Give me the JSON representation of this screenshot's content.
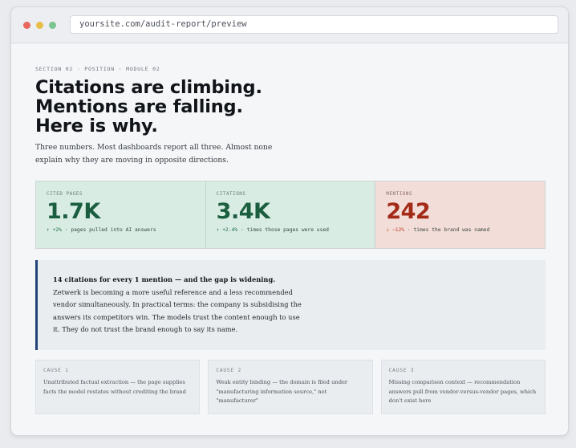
{
  "browser": {
    "url": "yoursite.com/audit-report/preview"
  },
  "header": {
    "eyebrow": "SECTION 02 · POSITION · MODULE 02",
    "headline_lines": [
      "Citations are climbing.",
      "Mentions are falling.",
      "Here is why."
    ],
    "subhead": "Three numbers. Most dashboards report all three. Almost none explain why they are moving in opposite directions."
  },
  "stats": [
    {
      "label": "CITED PAGES",
      "value": "1.7K",
      "arrow": "↑",
      "delta": "+2%",
      "note": "· pages pulled into AI answers",
      "tone": "green"
    },
    {
      "label": "CITATIONS",
      "value": "3.4K",
      "arrow": "↑",
      "delta": "+2.4%",
      "note": "· times those pages were used",
      "tone": "green"
    },
    {
      "label": "MENTIONS",
      "value": "242",
      "arrow": "↓",
      "delta": "−12%",
      "note": "· times the brand was named",
      "tone": "red"
    }
  ],
  "callout": {
    "lead": "14 citations for every 1 mention — and the gap is widening.",
    "body": "Zetwerk is becoming a more useful reference and a less recommended vendor simultaneously. In practical terms: the company is subsidising the answers its competitors win. The models trust the content enough to use it. They do not trust the brand enough to say its name."
  },
  "causes": [
    {
      "label": "CAUSE 1",
      "text": "Unattributed factual extraction — the page supplies facts the model restates without crediting the brand"
    },
    {
      "label": "CAUSE 2",
      "text": "Weak entity binding — the domain is filed under \"manufacturing information source,\" not \"manufacturer\""
    },
    {
      "label": "CAUSE 3",
      "text": "Missing comparison context — recommendation answers pull from vendor-versus-vendor pages, which don't exist here"
    }
  ],
  "colors": {
    "accent_navy": "#22427a",
    "positive_green": "#1b5e3f",
    "negative_red": "#a32a17"
  }
}
